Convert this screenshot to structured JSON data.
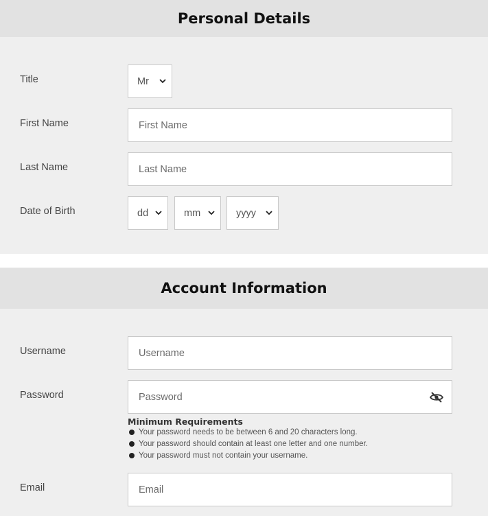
{
  "personal": {
    "heading": "Personal Details",
    "title": {
      "label": "Title",
      "value": "Mr"
    },
    "first_name": {
      "label": "First Name",
      "placeholder": "First Name"
    },
    "last_name": {
      "label": "Last Name",
      "placeholder": "Last Name"
    },
    "dob": {
      "label": "Date of Birth",
      "day": "dd",
      "month": "mm",
      "year": "yyyy"
    }
  },
  "account": {
    "heading": "Account Information",
    "username": {
      "label": "Username",
      "placeholder": "Username"
    },
    "password": {
      "label": "Password",
      "placeholder": "Password",
      "toggle_icon": "eye-slash-icon",
      "requirements_title": "Minimum Requirements",
      "requirements": [
        "Your password needs to be between 6 and 20 characters long.",
        "Your password should contain at least one letter and one number.",
        "Your password must not contain your username."
      ]
    },
    "email": {
      "label": "Email",
      "placeholder": "Email"
    }
  }
}
